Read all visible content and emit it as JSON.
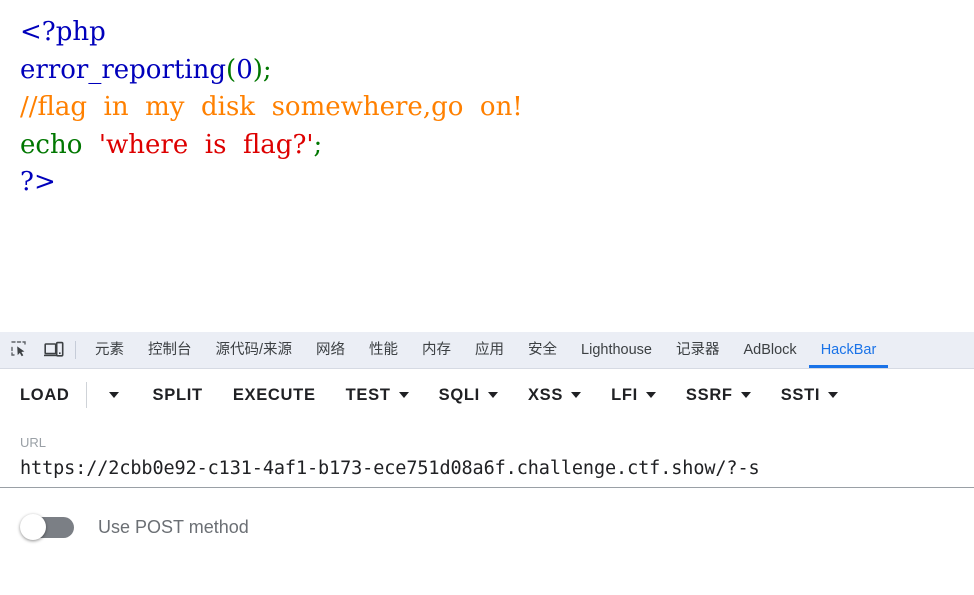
{
  "page": {
    "code_lines": [
      [
        {
          "t": "<?php",
          "c": "tok-tag"
        }
      ],
      [
        {
          "t": "error_reporting",
          "c": "tok-fn"
        },
        {
          "t": "(",
          "c": "tok-punc"
        },
        {
          "t": "0",
          "c": "tok-num"
        },
        {
          "t": ")",
          "c": "tok-punc"
        },
        {
          "t": ";",
          "c": "tok-punc"
        }
      ],
      [
        {
          "t": "//flag  in  my  disk  somewhere,go  on!",
          "c": "tok-cmt"
        }
      ],
      [
        {
          "t": "echo ",
          "c": "tok-kw"
        },
        {
          "t": " 'where  is  flag?'",
          "c": "tok-str"
        },
        {
          "t": ";",
          "c": "tok-punc"
        }
      ],
      [
        {
          "t": "?>",
          "c": "tok-tag"
        }
      ]
    ],
    "colors": {
      "tag": "#0000bb",
      "keyword": "#007700",
      "comment": "#ff8000",
      "string": "#dd0000"
    }
  },
  "devtools": {
    "icons": [
      {
        "name": "inspect-element-icon",
        "title": "Inspect element"
      },
      {
        "name": "device-toolbar-icon",
        "title": "Toggle device toolbar"
      }
    ],
    "tabs": [
      {
        "label": "元素",
        "active": false,
        "latin": false
      },
      {
        "label": "控制台",
        "active": false,
        "latin": false
      },
      {
        "label": "源代码/来源",
        "active": false,
        "latin": false
      },
      {
        "label": "网络",
        "active": false,
        "latin": false
      },
      {
        "label": "性能",
        "active": false,
        "latin": false
      },
      {
        "label": "内存",
        "active": false,
        "latin": false
      },
      {
        "label": "应用",
        "active": false,
        "latin": false
      },
      {
        "label": "安全",
        "active": false,
        "latin": false
      },
      {
        "label": "Lighthouse",
        "active": false,
        "latin": true
      },
      {
        "label": "记录器",
        "active": false,
        "latin": false
      },
      {
        "label": "AdBlock",
        "active": false,
        "latin": true
      },
      {
        "label": "HackBar",
        "active": true,
        "latin": true
      }
    ],
    "active_tab_color": "#1a73e8"
  },
  "hackbar": {
    "toolbar": [
      {
        "label": "LOAD",
        "caret": false
      },
      {
        "label": "",
        "caret": true,
        "caret_only": true
      },
      {
        "label": "SPLIT",
        "caret": false
      },
      {
        "label": "EXECUTE",
        "caret": false
      },
      {
        "label": "TEST",
        "caret": true
      },
      {
        "label": "SQLI",
        "caret": true
      },
      {
        "label": "XSS",
        "caret": true
      },
      {
        "label": "LFI",
        "caret": true
      },
      {
        "label": "SSRF",
        "caret": true
      },
      {
        "label": "SSTI",
        "caret": true
      }
    ],
    "url": {
      "label": "URL",
      "value": "https://2cbb0e92-c131-4af1-b173-ece751d08a6f.challenge.ctf.show/?-s",
      "placeholder": "URL"
    },
    "post_toggle": {
      "label": "Use POST method",
      "enabled": false
    }
  }
}
